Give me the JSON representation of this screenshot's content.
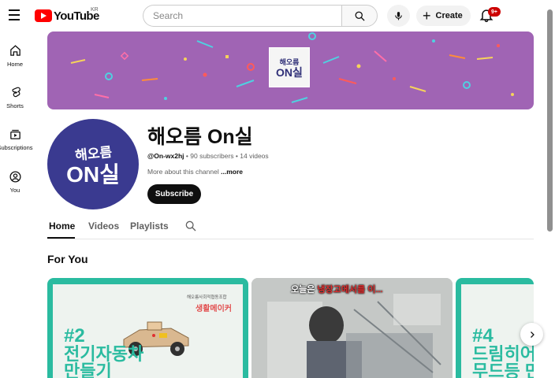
{
  "topbar": {
    "logo_text": "YouTube",
    "region": "KR",
    "search_placeholder": "Search",
    "create_label": "Create",
    "notification_count": "9+"
  },
  "sidebar": {
    "items": [
      {
        "label": "Home",
        "icon": "home-icon"
      },
      {
        "label": "Shorts",
        "icon": "shorts-icon"
      },
      {
        "label": "Subscriptions",
        "icon": "subscriptions-icon"
      },
      {
        "label": "You",
        "icon": "you-icon"
      }
    ]
  },
  "banner": {
    "logo_line1": "해오름",
    "logo_line2": "ON실",
    "background_color": "#a064b4"
  },
  "channel": {
    "avatar_line1": "해오름",
    "avatar_line2": "ON실",
    "name": "해오름 On실",
    "handle": "@On-wx2hj",
    "subscribers": "90 subscribers",
    "videos": "14 videos",
    "about": "More about this channel",
    "more": "...more",
    "subscribe_label": "Subscribe"
  },
  "tabs": [
    {
      "label": "Home",
      "active": true
    },
    {
      "label": "Videos",
      "active": false
    },
    {
      "label": "Playlists",
      "active": false
    }
  ],
  "section": {
    "title": "For You"
  },
  "cards": [
    {
      "org": "해오름사회적협동조합",
      "subtitle": "생활메이커",
      "number": "#2",
      "line1": "전기자동차",
      "line2": "만들기"
    },
    {
      "caption_white": "오늘은 ",
      "caption_red": "냉장고에서를 이..."
    },
    {
      "number": "#4",
      "line1": "드림히어",
      "line2": "무드등 만"
    }
  ],
  "colors": {
    "brand_red": "#ff0000",
    "teal": "#2abba0",
    "avatar_bg": "#3a3a90"
  }
}
